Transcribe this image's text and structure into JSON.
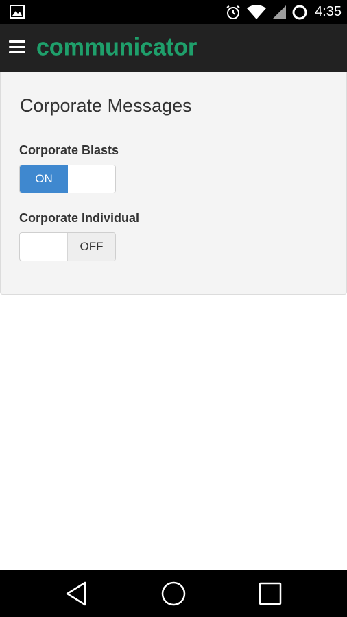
{
  "status_bar": {
    "time": "4:35",
    "icons": [
      "image-icon",
      "alarm-icon",
      "wifi-icon",
      "battery-icon"
    ]
  },
  "app_bar": {
    "brand": "communicator",
    "brand_color": "#1f9f6b",
    "menu_icon": "hamburger-menu-icon"
  },
  "panel": {
    "title": "Corporate Messages",
    "settings": [
      {
        "label": "Corporate Blasts",
        "state_label": "ON",
        "enabled": true
      },
      {
        "label": "Corporate Individual",
        "state_label": "OFF",
        "enabled": false
      }
    ],
    "accent_color": "#3f88cf"
  },
  "nav_bar": {
    "icons": [
      "back-icon",
      "home-icon",
      "recents-icon"
    ]
  }
}
